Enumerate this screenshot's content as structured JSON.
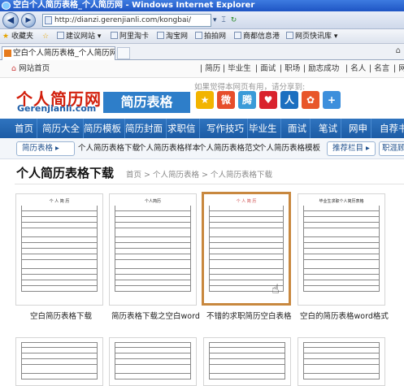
{
  "window": {
    "title": "空白个人简历表格_个人简历网 - Windows Internet Explorer"
  },
  "address": {
    "url": "http://dianzi.gerenjianli.com/kongbai/"
  },
  "favbar": {
    "favorites": "收藏夹",
    "items": [
      "建议网站 ▾",
      "阿里淘卡",
      "淘宝网",
      "拍拍网",
      "商都信息港",
      "网页快讯库 ▾"
    ]
  },
  "tab": {
    "label": "空白个人简历表格_个人简历网"
  },
  "topstrip": {
    "home": "网站首页",
    "links": [
      "简历",
      "毕业生",
      "面试",
      "职场",
      "励志成功",
      "名人",
      "名言",
      "网"
    ]
  },
  "header": {
    "logo_cn": "个人简历网",
    "logo_en": "Gerenjianli.com",
    "tag": "简历表格",
    "share_text": "如果觉得本网页有用，请分享到:"
  },
  "share_icons": [
    {
      "name": "qzone-icon",
      "glyph": "★",
      "color": "#f2b400"
    },
    {
      "name": "weibo-icon",
      "glyph": "微",
      "color": "#e64e2b"
    },
    {
      "name": "tencent-weibo-icon",
      "glyph": "腾",
      "color": "#3a9bd8"
    },
    {
      "name": "heart-icon",
      "glyph": "♥",
      "color": "#d9232d"
    },
    {
      "name": "renren-icon",
      "glyph": "人",
      "color": "#1c6fc0"
    },
    {
      "name": "kaixin-icon",
      "glyph": "✿",
      "color": "#e8562a"
    },
    {
      "name": "plus-icon",
      "glyph": "+",
      "color": "#3d8fdc"
    }
  ],
  "mainnav": [
    "首页",
    "简历大全",
    "简历模板",
    "简历封面",
    "求职信",
    "写作技巧",
    "毕业生",
    "面试",
    "笔试",
    "网申",
    "自荐书"
  ],
  "subnav": {
    "left_pill": "简历表格 ▸",
    "links": [
      "个人简历表格下载",
      "个人简历表格样本",
      "个人简历表格范文",
      "个人简历表格模板"
    ],
    "right_pill": "推荐栏目 ▸",
    "far_right": "职涯顾"
  },
  "content": {
    "title": "个人简历表格下载",
    "breadcrumb": "首页 > 个人简历表格 > 个人简历表格下载"
  },
  "cards": [
    {
      "caption": "空白简历表格下载"
    },
    {
      "caption": "简历表格下载之空白word"
    },
    {
      "caption": "不错的求职简历空白表格"
    },
    {
      "caption": "空白的简历表格word格式"
    }
  ],
  "card_doc_titles": [
    "个 人 简 历",
    "个人简历",
    "个 人 简 历",
    "毕业生求职个人简历表格"
  ]
}
